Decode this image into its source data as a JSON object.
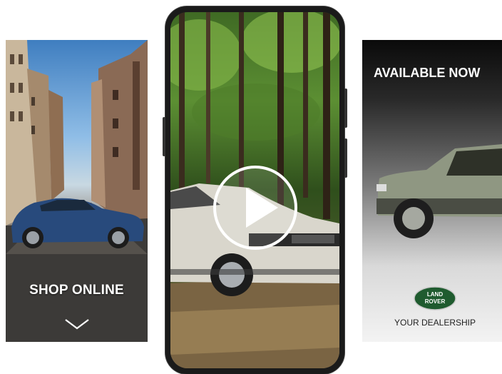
{
  "left_ad": {
    "cta": "SHOP ONLINE",
    "chevron_icon": "chevron-down-icon",
    "car_color": "#284a7c"
  },
  "video_ad": {
    "play_icon": "play-icon",
    "car_color": "#d9d6cc"
  },
  "right_ad": {
    "headline": "AVAILABLE NOW",
    "brand_logo_text": "LAND ROVER",
    "dealer": "YOUR DEALERSHIP",
    "car_color": "#8f9782",
    "logo_color": "#1f5b2f"
  }
}
